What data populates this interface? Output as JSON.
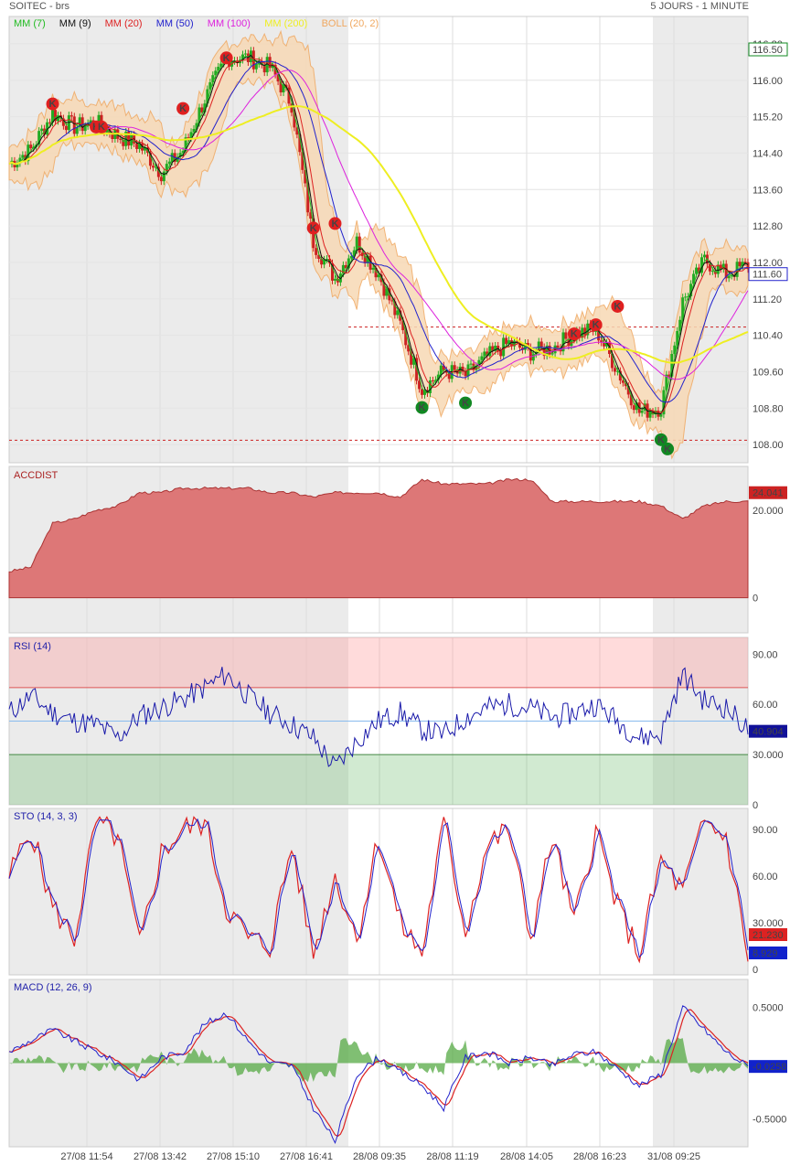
{
  "header": {
    "instrument": "SOITEC - brs",
    "period": "5 JOURS - 1 MINUTE"
  },
  "legend": [
    {
      "label": "MM (7)",
      "color": "#22bb22"
    },
    {
      "label": "MM (9)",
      "color": "#111111"
    },
    {
      "label": "MM (20)",
      "color": "#dd2222"
    },
    {
      "label": "MM (50)",
      "color": "#2222cc"
    },
    {
      "label": "MM (100)",
      "color": "#dd22dd"
    },
    {
      "label": "MM (200)",
      "color": "#eeee22"
    },
    {
      "label": "BOLL (20, 2)",
      "color": "#f0a860"
    }
  ],
  "x_ticks": [
    "27/08 11:54",
    "27/08 13:42",
    "27/08 15:10",
    "27/08 16:41",
    "28/08 09:35",
    "28/08 11:19",
    "28/08 14:05",
    "28/08 16:23",
    "31/08 09:25"
  ],
  "chart_data": [
    {
      "type": "line",
      "name": "price",
      "ylim": [
        107.5,
        117.2
      ],
      "y_ticks": [
        "116.80",
        "116.00",
        "115.20",
        "114.40",
        "113.60",
        "112.80",
        "112.00",
        "111.20",
        "110.40",
        "109.60",
        "108.80",
        "108.00"
      ],
      "last_price": "116.50",
      "current_value": "111.60",
      "reference_levels": [
        110.45,
        107.99
      ],
      "series": [
        {
          "name": "close",
          "values": [
            114.0,
            114.3,
            115.1,
            114.8,
            114.9,
            114.6,
            114.4,
            113.8,
            114.3,
            115.4,
            116.3,
            116.3,
            116.1,
            115.3,
            112.3,
            111.5,
            112.3,
            111.6,
            110.5,
            109.1,
            109.5,
            109.4,
            109.8,
            110.1,
            109.9,
            110.0,
            110.3,
            110.4,
            109.5,
            108.6,
            108.7,
            111.0,
            111.9,
            111.6,
            111.8
          ]
        }
      ],
      "signals": [
        {
          "label": "K",
          "type": "sell"
        },
        {
          "label": "K",
          "type": "sell"
        },
        {
          "label": "K",
          "type": "sell"
        },
        {
          "label": "K",
          "type": "sell"
        },
        {
          "label": "K",
          "type": "sell"
        },
        {
          "label": "K",
          "type": "sell"
        },
        {
          "label": "K",
          "type": "sell"
        },
        {
          "label": "K",
          "type": "sell"
        },
        {
          "label": "K",
          "type": "sell"
        },
        {
          "label": "K",
          "type": "sell"
        },
        {
          "label": "K",
          "type": "buy"
        },
        {
          "label": "K",
          "type": "buy"
        },
        {
          "label": "K",
          "type": "buy"
        },
        {
          "label": "K",
          "type": "buy"
        }
      ]
    },
    {
      "type": "area",
      "name": "ACCDIST",
      "ylim": [
        -8,
        30
      ],
      "y_ticks": [
        "20.000",
        "0"
      ],
      "current_value": "24.041",
      "values": [
        6,
        7,
        17,
        18,
        20,
        21,
        24,
        24,
        25,
        25,
        25,
        25,
        24,
        24,
        23,
        24,
        24,
        24,
        23,
        27,
        26,
        26,
        26,
        27,
        27,
        22,
        22,
        22,
        22,
        22,
        21,
        18,
        21,
        22,
        22
      ]
    },
    {
      "type": "line",
      "name": "RSI (14)",
      "ylim": [
        0,
        100
      ],
      "y_ticks": [
        "90.00",
        "60.00",
        "30.000",
        "0"
      ],
      "current_value": "40.904",
      "bands": [
        70,
        50,
        30
      ],
      "values": [
        55,
        65,
        55,
        50,
        48,
        40,
        53,
        58,
        63,
        70,
        78,
        65,
        55,
        48,
        40,
        22,
        38,
        50,
        55,
        45,
        42,
        52,
        58,
        60,
        58,
        52,
        55,
        60,
        50,
        40,
        42,
        78,
        62,
        58,
        45
      ]
    },
    {
      "type": "line",
      "name": "STO (14, 3, 3)",
      "ylim": [
        0,
        100
      ],
      "y_ticks": [
        "90.00",
        "60.00",
        "30.000",
        "0"
      ],
      "current_values": [
        "21.230",
        "8.929"
      ],
      "values": [
        60,
        90,
        40,
        20,
        95,
        85,
        15,
        75,
        90,
        95,
        40,
        20,
        15,
        80,
        10,
        60,
        20,
        85,
        30,
        10,
        95,
        25,
        80,
        90,
        20,
        85,
        30,
        90,
        40,
        10,
        70,
        50,
        95,
        85,
        9
      ]
    },
    {
      "type": "line",
      "name": "MACD (12, 26, 9)",
      "ylim": [
        -0.75,
        0.75
      ],
      "y_ticks": [
        "0.5000",
        "-0.5000"
      ],
      "current_value": "-0.0258",
      "values": [
        0.1,
        0.2,
        0.3,
        0.2,
        0.1,
        0.0,
        -0.15,
        0.05,
        0.1,
        0.35,
        0.45,
        0.2,
        0.0,
        -0.02,
        -0.4,
        -0.7,
        -0.1,
        0.05,
        -0.08,
        -0.2,
        -0.4,
        0.05,
        0.1,
        0.0,
        0.05,
        -0.02,
        0.08,
        0.1,
        -0.05,
        -0.2,
        -0.1,
        0.5,
        0.3,
        0.1,
        -0.03
      ]
    }
  ]
}
